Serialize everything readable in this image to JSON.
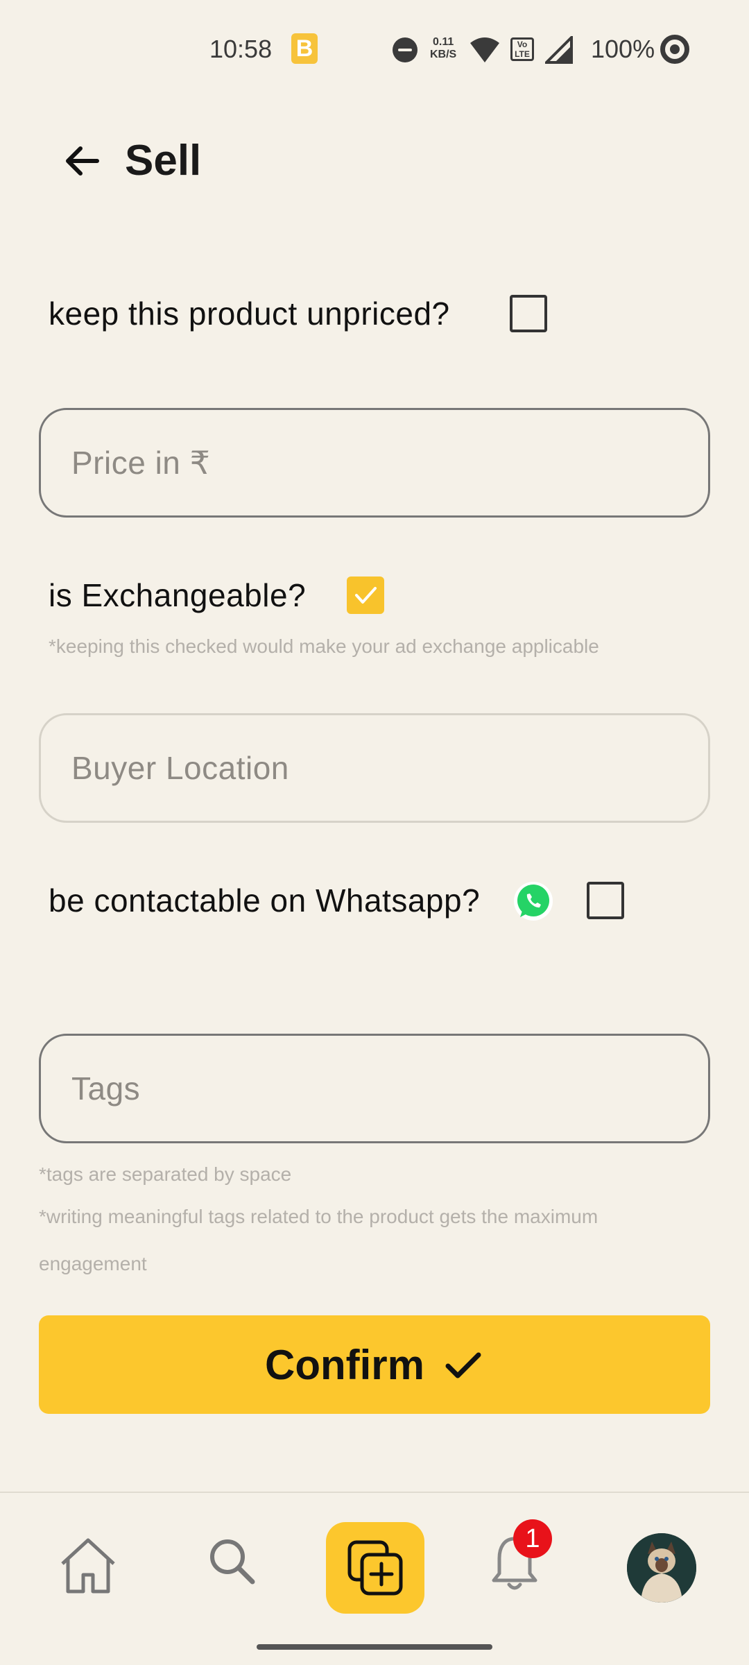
{
  "status_bar": {
    "time": "10:58",
    "app_badge": "B",
    "net_speed_value": "0.11",
    "net_speed_unit": "KB/S",
    "lte_label": "Vo LTE",
    "battery": "100%"
  },
  "header": {
    "title": "Sell"
  },
  "unpriced": {
    "label": "keep this product unpriced?",
    "checked": false
  },
  "price_field": {
    "placeholder": "Price in ₹",
    "value": ""
  },
  "exchangeable": {
    "label": "is Exchangeable?",
    "checked": true,
    "hint": "*keeping this checked would make your ad exchange applicable"
  },
  "buyer_location_field": {
    "placeholder": "Buyer Location",
    "value": ""
  },
  "whatsapp": {
    "label": "be contactable on Whatsapp?",
    "checked": false
  },
  "tags_field": {
    "placeholder": "Tags",
    "value": "",
    "hint1": "*tags are separated by space",
    "hint2_line1": "*writing meaningful tags related to the product gets the maximum",
    "hint2_line2": "engagement"
  },
  "confirm_button": {
    "label": "Confirm"
  },
  "bottom_nav": {
    "items": [
      "home",
      "search",
      "add-post",
      "notifications",
      "profile"
    ],
    "notification_count": "1"
  },
  "colors": {
    "accent": "#fcc72d",
    "background": "#f5f1e8",
    "badge": "#e8121a",
    "whatsapp": "#25d366"
  }
}
